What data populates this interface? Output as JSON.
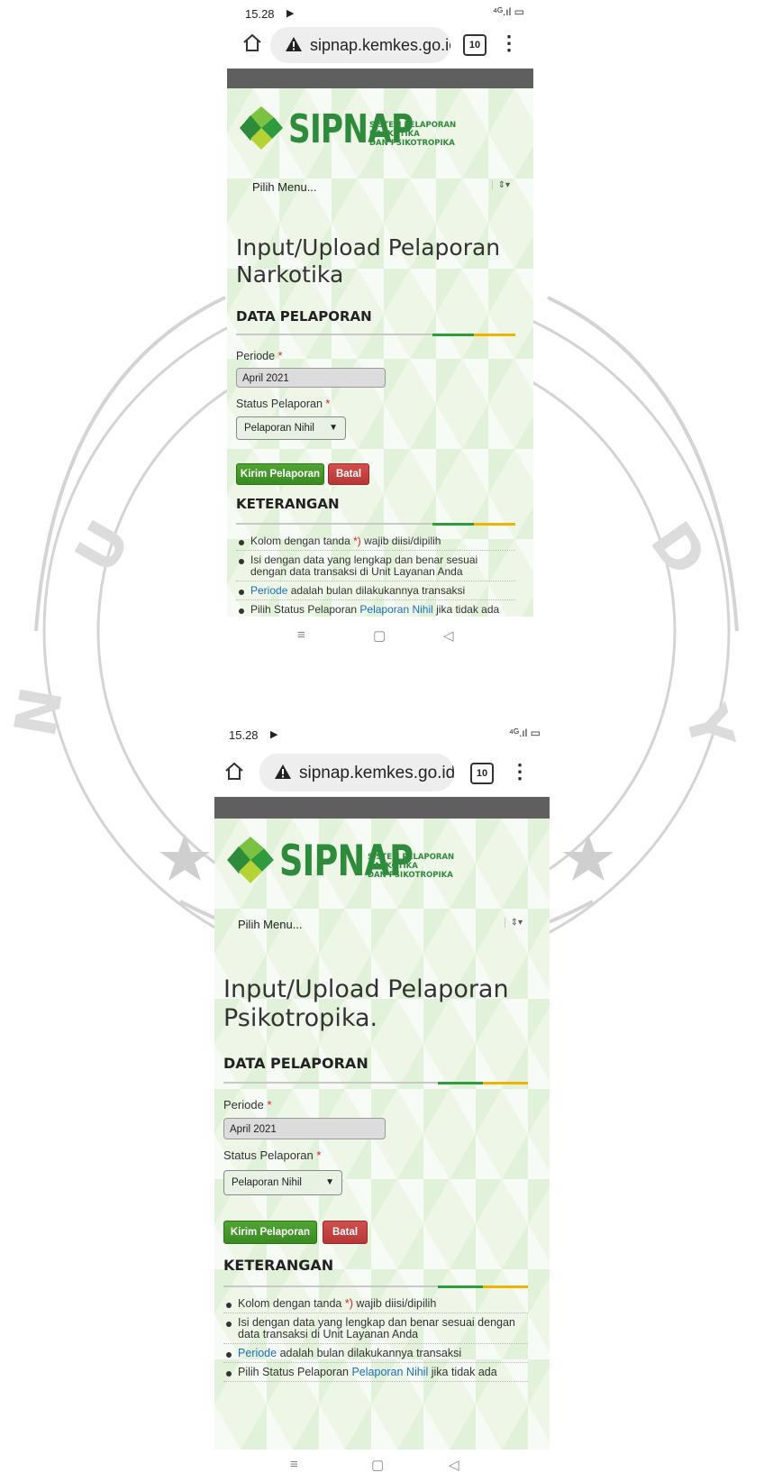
{
  "status_bar": {
    "time": "15.28",
    "play_glyph": "▶",
    "signal": "⁴ᴳ.ıl",
    "battery_glyph": "▭"
  },
  "browser": {
    "url": "sipnap.kemkes.go.id/se",
    "tab_count": "10",
    "menu_glyph": "⋮",
    "home_icon": "home-icon",
    "warning_icon": "warning-icon"
  },
  "logo": {
    "name": "SIPNAP",
    "sub_line_1": "SISTEM PELAPORAN",
    "sub_line_2": "NARKOTIKA",
    "sub_line_3": "DAN PSIKOTROPIKA"
  },
  "menu": {
    "label": "Pilih Menu..."
  },
  "screen1": {
    "title_line_1": "Input/Upload Pelaporan",
    "title_line_2": "Narkotika"
  },
  "screen2": {
    "title_line_1": "Input/Upload Pelaporan",
    "title_line_2": "Psikotropika."
  },
  "form": {
    "section_title": "DATA PELAPORAN",
    "periode_label": "Periode",
    "periode_value": "April 2021",
    "status_label": "Status Pelaporan",
    "status_value": "Pelaporan Nihil",
    "required_mark": "*",
    "submit_label": "Kirim Pelaporan",
    "cancel_label": "Batal"
  },
  "notes": {
    "section_title": "KETERANGAN",
    "item1_a": "Kolom dengan tanda ",
    "item1_mark": "*)",
    "item1_b": " wajib diisi/dipilih",
    "item2": "Isi dengan data yang lengkap dan benar sesuai dengan data transaksi di Unit Layanan Anda",
    "item3_link": "Periode",
    "item3_rest": " adalah bulan dilakukannya transaksi",
    "item4_a": "Pilih Status Pelaporan ",
    "item4_link": "Pelaporan Nihil",
    "item4_b": " jika tidak ada"
  },
  "navbar": {
    "menu_glyph": "≡",
    "home_glyph": "▢",
    "back_glyph": "◁"
  },
  "colors": {
    "brand_green": "#2e8b3b",
    "btn_green": "#3a8a22",
    "btn_red": "#b83636",
    "rule_green": "#2e9c3d",
    "rule_yellow": "#f0b400"
  }
}
